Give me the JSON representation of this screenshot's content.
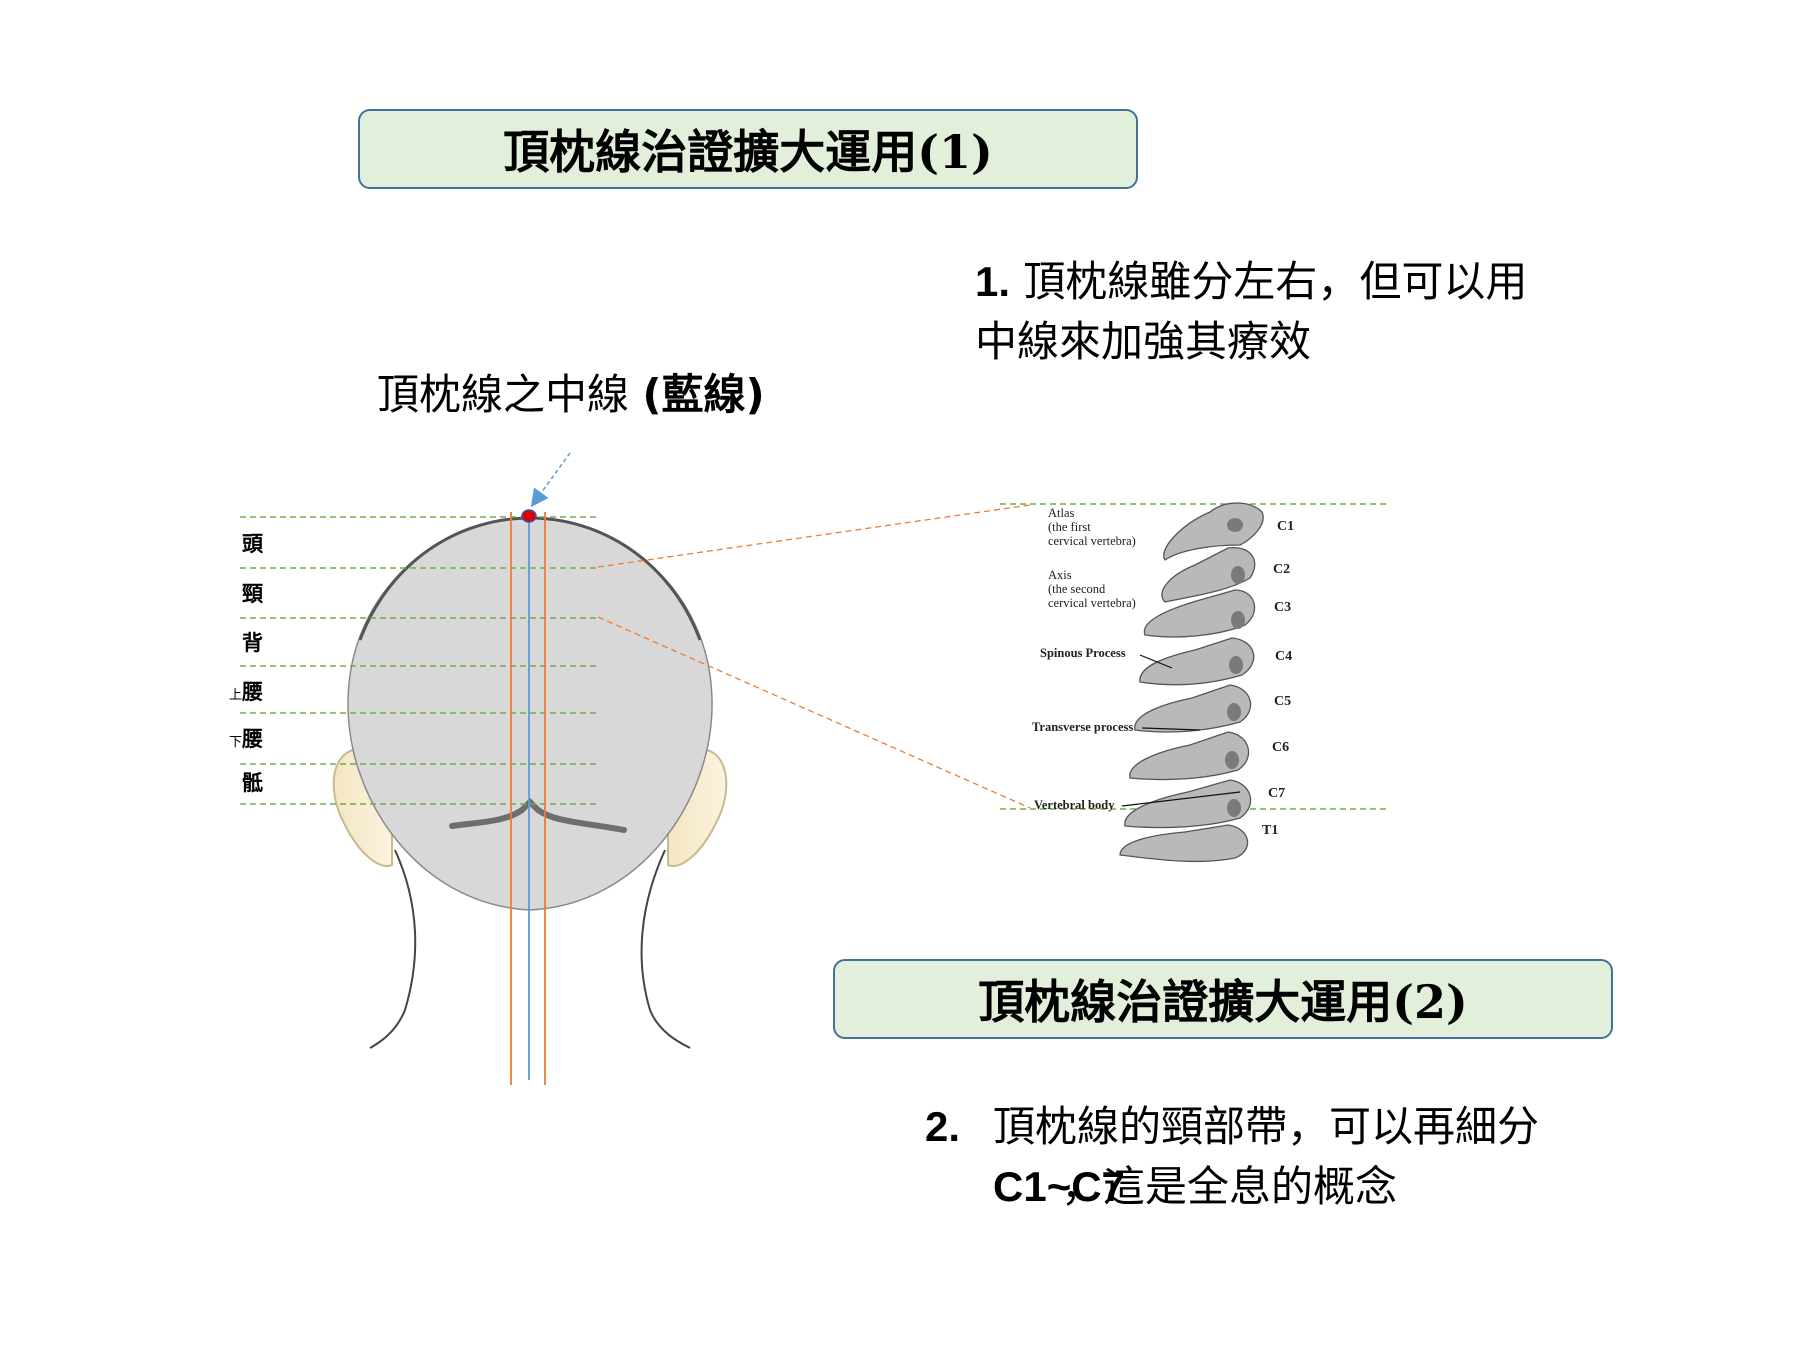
{
  "titles": {
    "title1": "頂枕線治證擴大運用(1)",
    "title2": "頂枕線治證擴大運用(2)"
  },
  "midline_label": {
    "main": "頂枕線之中線 ",
    "paren": "(藍線)"
  },
  "point1": {
    "num": "1.",
    "line1": " 頂枕線雖分左右，但可以用",
    "line2": "中線來加強其療效"
  },
  "point2": {
    "num": "2.",
    "line1": "頂枕線的頸部帶，可以再細分",
    "line2_bold": "C1~C7",
    "line2_rest": "，這是全息的概念"
  },
  "zones": [
    {
      "prefix": "",
      "label": "頭"
    },
    {
      "prefix": "",
      "label": "頸"
    },
    {
      "prefix": "",
      "label": "背"
    },
    {
      "prefix": "上",
      "label": "腰"
    },
    {
      "prefix": "下",
      "label": "腰"
    },
    {
      "prefix": "",
      "label": "骶"
    }
  ],
  "vertebra_labels": {
    "left": [
      [
        "Atlas",
        "(the first",
        "cervical vertebra)"
      ],
      [
        "Axis",
        "(the second",
        "cervical vertebra)"
      ],
      [
        "Spinous Process"
      ],
      [
        "Transverse process"
      ],
      [
        "Vertebral body"
      ]
    ],
    "right": [
      "C1",
      "C2",
      "C3",
      "C4",
      "C5",
      "C6",
      "C7",
      "T1"
    ]
  },
  "colors": {
    "title_fill": "#e2efda",
    "title_border": "#41719c",
    "zone_line": "#70ad47",
    "orange_line": "#ed7d31",
    "blue_line": "#5b9bd5",
    "red_point": "#e00000",
    "head_fill": "#d8d8d8"
  }
}
